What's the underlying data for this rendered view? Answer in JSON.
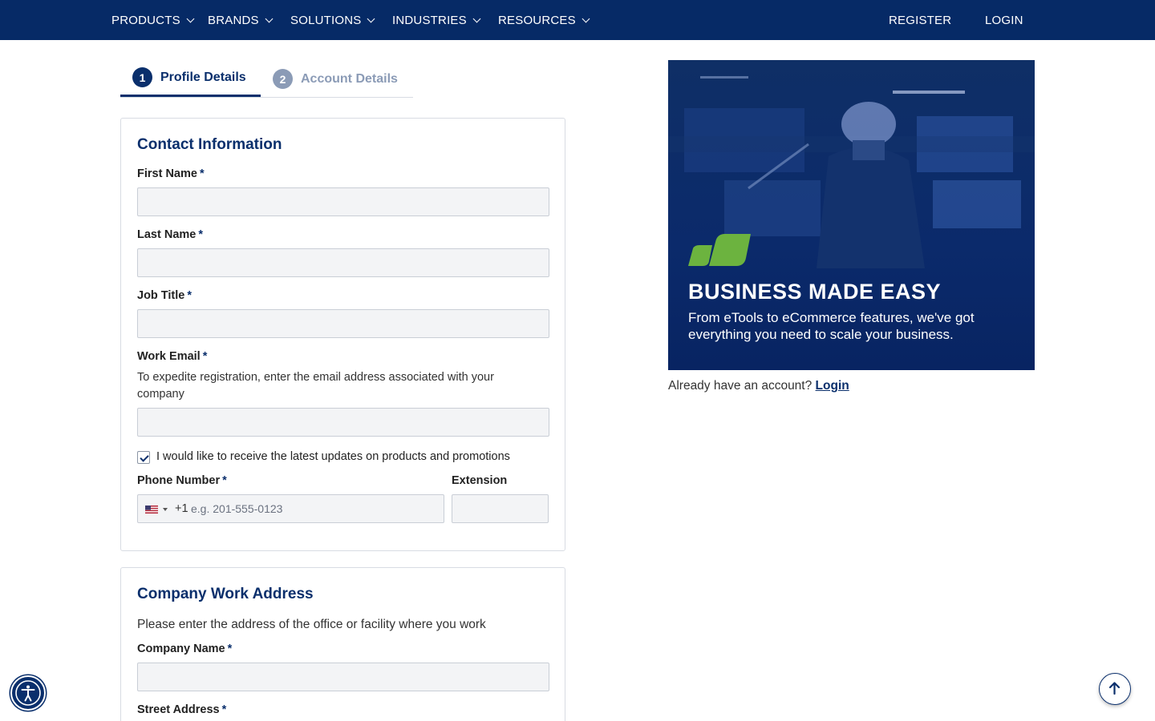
{
  "nav": {
    "products": "PRODUCTS",
    "brands": "BRANDS",
    "solutions": "SOLUTIONS",
    "industries": "INDUSTRIES",
    "resources": "RESOURCES",
    "register": "REGISTER",
    "login": "LOGIN"
  },
  "steps": [
    {
      "num": "1",
      "label": "Profile Details",
      "active": true
    },
    {
      "num": "2",
      "label": "Account Details",
      "active": false
    }
  ],
  "contact": {
    "title": "Contact Information",
    "required_mark": "*",
    "first_name_label": "First Name",
    "last_name_label": "Last Name",
    "job_title_label": "Job Title",
    "work_email_label": "Work Email",
    "work_email_help": "To expedite registration, enter the email address associated with your company",
    "updates_checkbox_label": "I would like to receive the latest updates on products and promotions",
    "updates_checked": true,
    "phone_label": "Phone Number",
    "phone_country_code": "+1",
    "phone_placeholder": "e.g. 201-555-0123",
    "extension_label": "Extension",
    "first_name_value": "",
    "last_name_value": "",
    "job_title_value": "",
    "work_email_value": ""
  },
  "address": {
    "title": "Company Work Address",
    "help": "Please enter the address of the office or facility where you work",
    "company_name_label": "Company Name",
    "street_address_label": "Street Address"
  },
  "promo": {
    "title": "BUSINESS MADE EASY",
    "text": "From eTools to eCommerce features, we've got everything you need to scale your business."
  },
  "already": {
    "prompt": "Already have an account?",
    "link": "Login"
  },
  "icons": {
    "accessibility": "accessibility-icon",
    "back_to_top": "arrow-up-icon",
    "country_flag": "us-flag-icon",
    "brand_mark": "leaf-logo-icon"
  },
  "colors": {
    "nav_bg": "#062a66",
    "accent": "#0a2f6c",
    "inactive_step": "#8b9bb6",
    "brand_green": "#6cb33f",
    "input_bg": "#f3f4f6"
  }
}
